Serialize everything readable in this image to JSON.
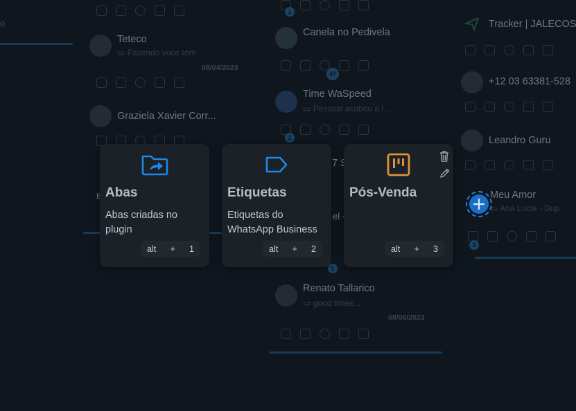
{
  "background": {
    "column_1": {
      "contacts": [
        {
          "name": "Teteco",
          "message": "Fazendo voce tem",
          "date": "08/04/2023"
        },
        {
          "name": "Graziela Xavier Corr..."
        }
      ]
    },
    "column_2": {
      "contacts": [
        {
          "name": "Canela no Pedivela",
          "badge": "47"
        },
        {
          "name": "Time WaSpeed",
          "message": "Pessoal acabou a l..."
        },
        {
          "name": "Renato Tallarico",
          "message": "good times...",
          "date": "08/06/2023"
        }
      ],
      "badges": [
        "1",
        "2",
        "1"
      ],
      "fragments": [
        "7 S",
        "el -"
      ]
    },
    "column_3": {
      "contacts": [
        {
          "name": "Tracker | JALECOS"
        },
        {
          "name": "+12 03 63381-528"
        },
        {
          "name": "Leandro Guru"
        },
        {
          "name": "Meu Amor",
          "message": "Ana Lucia - Dup"
        }
      ],
      "badges": [
        "3"
      ]
    },
    "fragments": [
      "B",
      "o"
    ]
  },
  "shortcuts": [
    {
      "title": "Abas",
      "description": "Abas criadas no plugin",
      "key_modifier": "alt",
      "key_plus": "+",
      "key_number": "1",
      "icon": "folder-share-icon",
      "icon_color": "#1e88e5"
    },
    {
      "title": "Etiquetas",
      "description": "Etiquetas do WhatsApp Business",
      "key_modifier": "alt",
      "key_plus": "+",
      "key_number": "2",
      "icon": "tag-icon",
      "icon_color": "#1e88e5"
    },
    {
      "title": "Pós-Venda",
      "description": "",
      "key_modifier": "alt",
      "key_plus": "+",
      "key_number": "3",
      "icon": "kanban-board-icon",
      "icon_color": "#e0913a"
    }
  ],
  "add_button": {
    "icon": "plus-icon",
    "color": "#1e88e5"
  }
}
